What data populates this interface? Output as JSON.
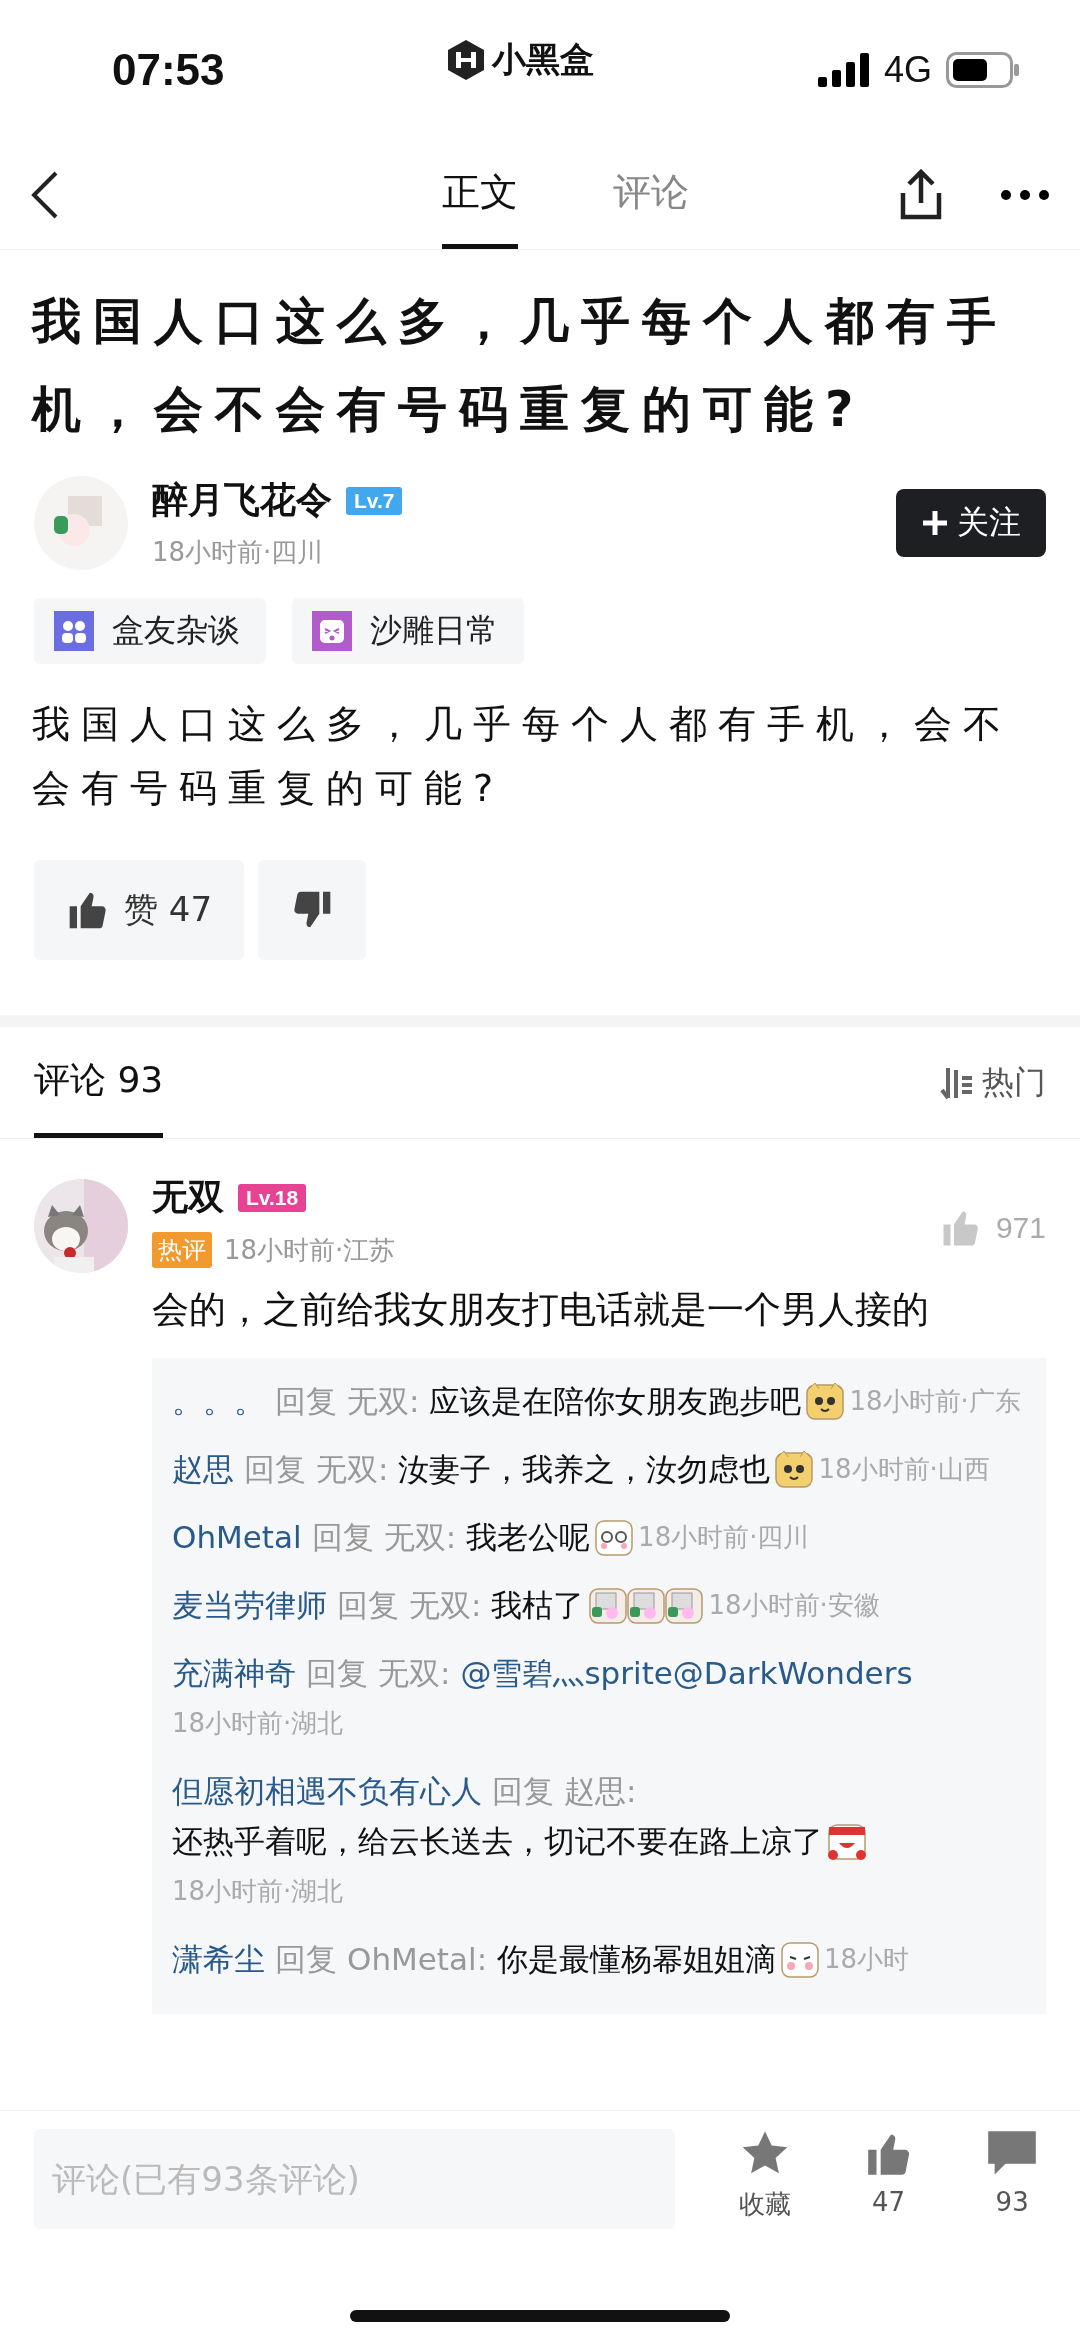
{
  "status_bar": {
    "time": "07:53",
    "app": "小黑盒",
    "network": "4G"
  },
  "nav": {
    "tabs": [
      {
        "label": "正文",
        "selected": true
      },
      {
        "label": "评论",
        "selected": false
      }
    ]
  },
  "post": {
    "title": "我国人口这么多，几乎每个人都有手机，会不会有号码重复的可能?",
    "author": {
      "name": "醉月飞花令",
      "level": "Lv.7",
      "meta": "18小时前·四川",
      "follow": "关注"
    },
    "tags": [
      {
        "label": "盒友杂谈"
      },
      {
        "label": "沙雕日常"
      }
    ],
    "body": "我国人口这么多，几乎每个人都有手机，会不会有号码重复的可能?",
    "like": {
      "label": "赞",
      "count": "47"
    }
  },
  "comments_header": {
    "tab": {
      "label": "评论",
      "count": "93",
      "selected": true
    },
    "sort": "热门"
  },
  "comment": {
    "name": "无双",
    "level": "Lv.18",
    "badge": "热评",
    "meta": "18小时前·江苏",
    "likes": "971",
    "text": "会的，之前给我女朋友打电话就是一个男人接的",
    "replies": [
      {
        "user": "。。。",
        "reply_label": "回复",
        "target": "无双:",
        "text": "应该是在陪你女朋友跑步吧",
        "emojis": [
          {
            "kind": "cat"
          }
        ],
        "time": "18小时前·广东"
      },
      {
        "user": "赵思",
        "reply_label": "回复",
        "target": "无双:",
        "text": "汝妻子，我养之，汝勿虑也",
        "emojis": [
          {
            "kind": "cat"
          }
        ],
        "time": "18小时前·山西"
      },
      {
        "user": "OhMetal",
        "reply_label": "回复",
        "target": "无双:",
        "text": "我老公呢",
        "emojis": [
          {
            "kind": "dizzy"
          }
        ],
        "time": "18小时前·四川"
      },
      {
        "user": "麦当劳律师",
        "reply_label": "回复",
        "target": "无双:",
        "text": "我枯了",
        "emojis": [
          {
            "kind": "figure"
          },
          {
            "kind": "figure"
          },
          {
            "kind": "figure"
          }
        ],
        "time": "18小时前·安徽"
      },
      {
        "user": "充满神奇",
        "reply_label": "回复",
        "target": "无双:",
        "mention": "@雪碧灬sprite@DarkWonders",
        "time": "18小时前·湖北"
      },
      {
        "user": "但愿初相遇不负有心人",
        "reply_label": "回复",
        "target": "赵思:",
        "text": "还热乎着呢，给云长送去，切记不要在路上凉了",
        "emojis": [
          {
            "kind": "headband"
          }
        ],
        "time": "18小时前·湖北"
      },
      {
        "user": "潇希尘",
        "reply_label": "回复",
        "target": "OhMetal:",
        "text": "你是最懂杨幂姐姐滴",
        "emojis": [
          {
            "kind": "blush"
          }
        ],
        "time": "18小时"
      }
    ]
  },
  "bottom_bar": {
    "placeholder": "评论(已有93条评论)",
    "actions": [
      {
        "label": "收藏"
      },
      {
        "label": "47"
      },
      {
        "label": "93"
      }
    ]
  }
}
